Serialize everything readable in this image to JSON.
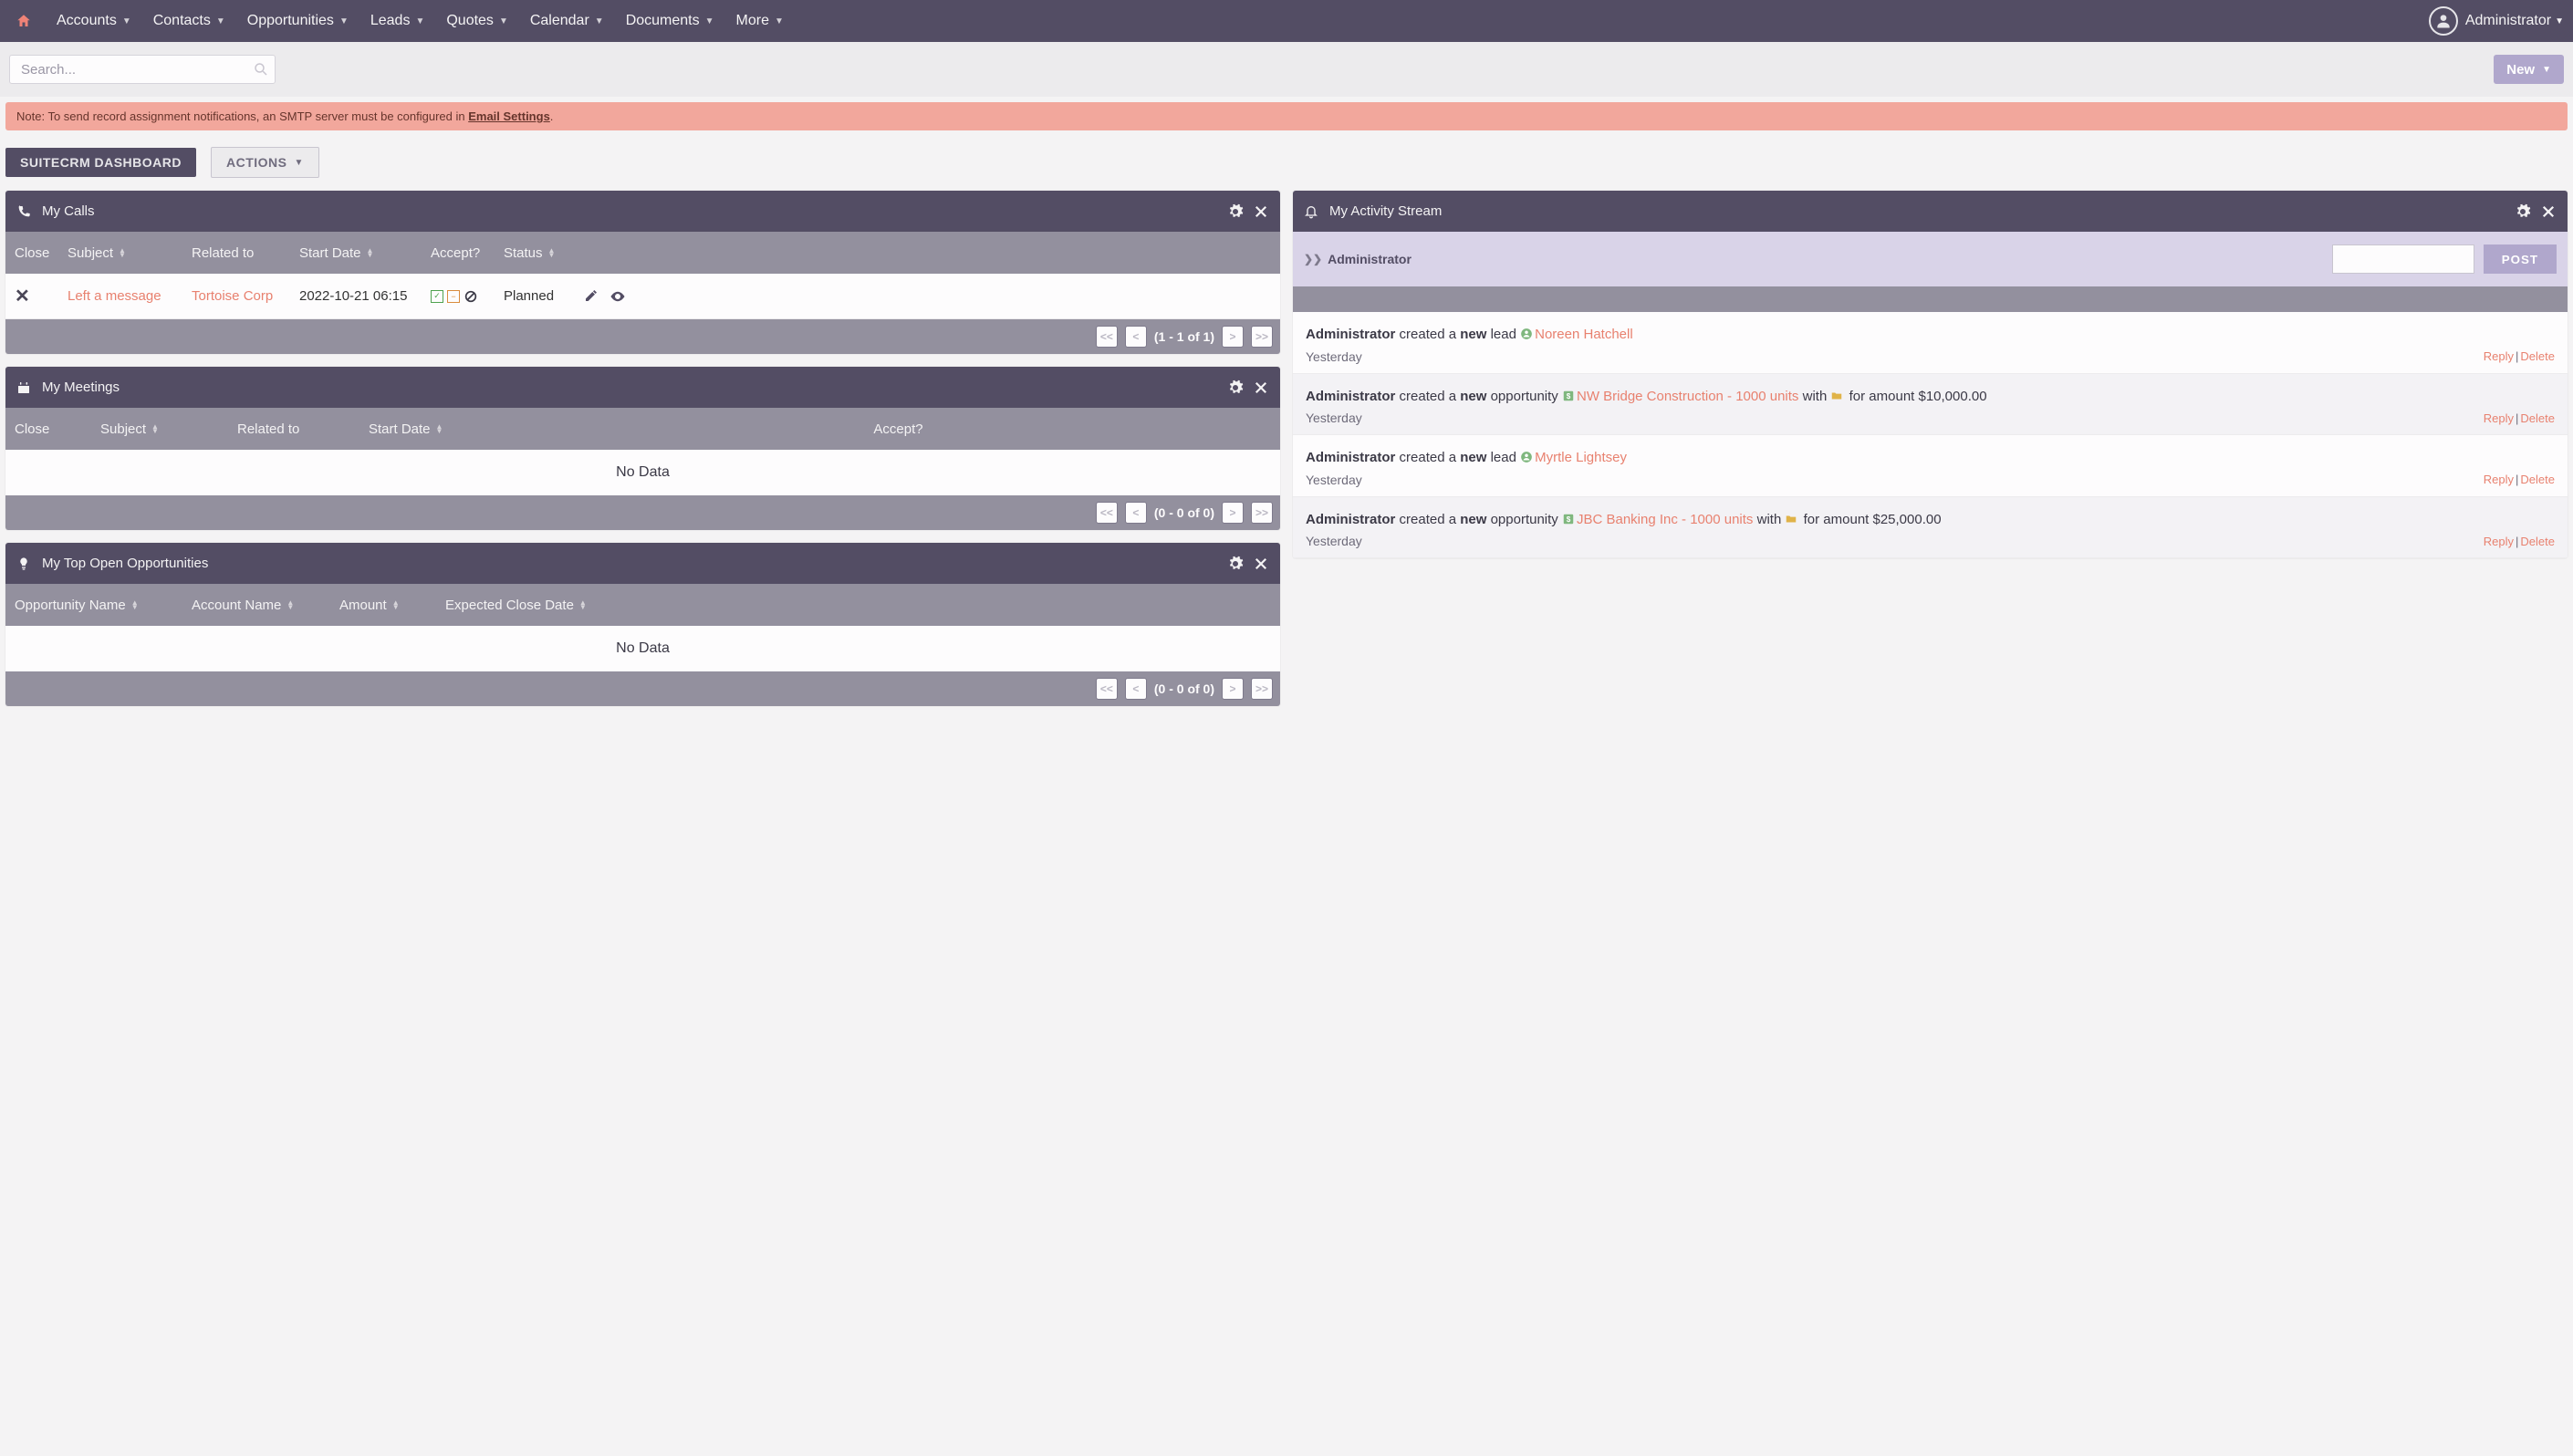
{
  "nav": {
    "items": [
      "Accounts",
      "Contacts",
      "Opportunities",
      "Leads",
      "Quotes",
      "Calendar",
      "Documents",
      "More"
    ],
    "user": "Administrator"
  },
  "search": {
    "placeholder": "Search..."
  },
  "new_button": "New",
  "alert": {
    "prefix": "Note: To send record assignment notifications, an SMTP server must be configured in ",
    "link": "Email Settings",
    "suffix": "."
  },
  "page_title": "SUITECRM DASHBOARD",
  "actions_label": "ACTIONS",
  "panels": {
    "calls": {
      "title": "My Calls",
      "cols": {
        "close": "Close",
        "subject": "Subject",
        "related": "Related to",
        "start": "Start Date",
        "accept": "Accept?",
        "status": "Status"
      },
      "rows": [
        {
          "subject": "Left a message",
          "related": "Tortoise Corp",
          "start": "2022-10-21 06:15",
          "status": "Planned"
        }
      ],
      "pager": "(1 - 1 of 1)"
    },
    "meetings": {
      "title": "My Meetings",
      "cols": {
        "close": "Close",
        "subject": "Subject",
        "related": "Related to",
        "start": "Start Date",
        "accept": "Accept?"
      },
      "no_data": "No Data",
      "pager": "(0 - 0 of 0)"
    },
    "opps": {
      "title": "My Top Open Opportunities",
      "cols": {
        "name": "Opportunity Name",
        "account": "Account Name",
        "amount": "Amount",
        "close_date": "Expected Close Date"
      },
      "no_data": "No Data",
      "pager": "(0 - 0 of 0)"
    },
    "activity": {
      "title": "My Activity Stream",
      "composer": {
        "who": "Administrator",
        "post": "POST"
      },
      "items": [
        {
          "user": "Administrator",
          "verb": " created a ",
          "bold": "new",
          "tail1": " lead ",
          "icon": "lead",
          "rec": "Noreen Hatchell",
          "tail2": "",
          "time": "Yesterday"
        },
        {
          "user": "Administrator",
          "verb": " created a ",
          "bold": "new",
          "tail1": " opportunity ",
          "icon": "opp",
          "rec": "NW Bridge Construction - 1000 units",
          "tail2": " with ",
          "icon2": "folder",
          "tail3": " for amount $10,000.00",
          "time": "Yesterday"
        },
        {
          "user": "Administrator",
          "verb": " created a ",
          "bold": "new",
          "tail1": " lead ",
          "icon": "lead",
          "rec": "Myrtle Lightsey",
          "tail2": "",
          "time": "Yesterday"
        },
        {
          "user": "Administrator",
          "verb": " created a ",
          "bold": "new",
          "tail1": " opportunity ",
          "icon": "opp",
          "rec": "JBC Banking Inc - 1000 units",
          "tail2": " with ",
          "icon2": "folder",
          "tail3": " for amount $25,000.00",
          "time": "Yesterday"
        }
      ],
      "reply": "Reply",
      "delete": "Delete"
    }
  },
  "pager_btns": {
    "first": "<<",
    "prev": "<",
    "next": ">",
    "last": ">>"
  }
}
